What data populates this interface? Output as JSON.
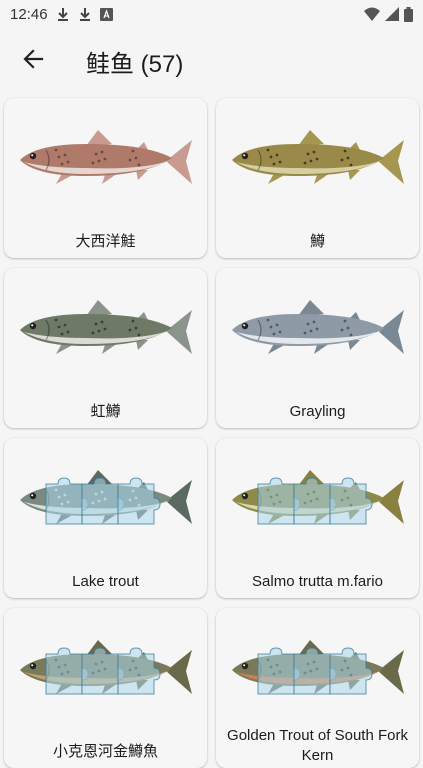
{
  "status": {
    "time": "12:46",
    "icons": [
      "download-icon",
      "download-icon",
      "a-box-icon",
      "wifi-icon",
      "signal-icon",
      "battery-icon"
    ]
  },
  "appbar": {
    "title": "鲑鱼 (57)",
    "back_icon": "arrow-back-icon"
  },
  "fish": [
    {
      "label": "大西洋鮭",
      "locked": false,
      "body": "#b07a6a",
      "belly": "#e6d6d0",
      "fin": "#c89a90",
      "spots": "#6a4a40"
    },
    {
      "label": "鱒",
      "locked": false,
      "body": "#9a8a4a",
      "belly": "#d8cfa0",
      "fin": "#a59650",
      "spots": "#4a3a20"
    },
    {
      "label": "虹鱒",
      "locked": false,
      "body": "#6e7a66",
      "belly": "#dcdcd6",
      "fin": "#8a948a",
      "spots": "#3a4032"
    },
    {
      "label": "Grayling",
      "locked": false,
      "body": "#8e9aa6",
      "belly": "#e4e8ec",
      "fin": "#7a8894",
      "spots": "#505a66"
    },
    {
      "label": "Lake trout",
      "locked": true,
      "body": "#7a8a80",
      "belly": "#d8e0dc",
      "fin": "#5a6a60",
      "spots": "#d0d8d0"
    },
    {
      "label": "Salmo trutta m.fario",
      "locked": true,
      "body": "#8e8a4a",
      "belly": "#dcd8b0",
      "fin": "#8a8040",
      "spots": "#3a3418"
    },
    {
      "label": "小克恩河金鱒魚",
      "locked": true,
      "body": "#7a7a5a",
      "belly": "#c0a070",
      "fin": "#6a6a4a",
      "spots": "#2a2a20"
    },
    {
      "label": "Golden Trout of South Fork Kern",
      "locked": true,
      "body": "#7a7a5a",
      "belly": "#d08050",
      "fin": "#6a6a4a",
      "spots": "#2a2a20"
    }
  ]
}
